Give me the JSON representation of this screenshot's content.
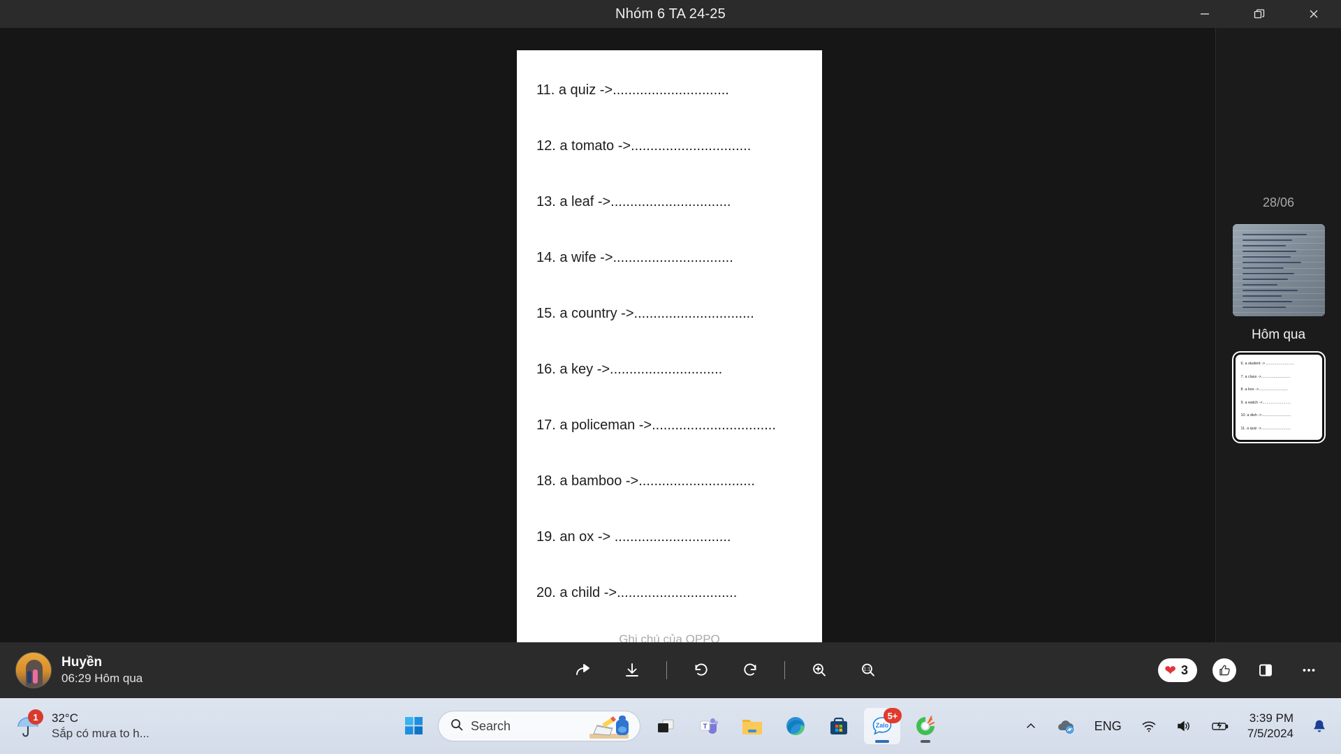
{
  "window": {
    "title": "Nhóm 6 TA 24-25",
    "controls": {
      "minimize": "minimize-button",
      "restore": "restore-button",
      "close": "close-button"
    }
  },
  "document": {
    "lines": [
      "11. a quiz ->..............................",
      "12. a tomato ->...............................",
      "13. a leaf ->...............................",
      "14. a wife ->...............................",
      "15. a country ->...............................",
      "16. a key ->.............................",
      "17. a policeman ->................................",
      "18. a bamboo ->..............................",
      "19. an ox -> ..............................",
      "20. a child ->..............................."
    ],
    "watermark": "Ghi chú của OPPO"
  },
  "rail": {
    "date_label": "28/06",
    "group_label": "Hôm qua",
    "photo_thumb_name": "handwritten-notebook-photo",
    "doc_thumb_lines": [
      "6. a student -> ...........................",
      "7. a class ->............................",
      "8. a box ->............................",
      "9. a watch ->...........................",
      "10. a dish ->............................",
      "11. a quiz ->............................"
    ]
  },
  "actionbar": {
    "author_name": "Huyền",
    "author_time": "06:29 Hôm qua",
    "tools": [
      {
        "name": "share-forward-icon",
        "label": "Chuyển tiếp"
      },
      {
        "name": "download-icon",
        "label": "Tải xuống"
      },
      {
        "name": "rotate-left-icon",
        "label": "Xoay trái"
      },
      {
        "name": "rotate-right-icon",
        "label": "Xoay phải"
      },
      {
        "name": "zoom-in-icon",
        "label": "Phóng to"
      },
      {
        "name": "zoom-actual-size-icon",
        "label": "1:1"
      }
    ],
    "reaction_emoji": "❤",
    "reaction_count": "3",
    "like_icon": "thumbs-up-icon",
    "panel_icon": "side-panel-icon",
    "more_icon": "more-options-icon"
  },
  "taskbar": {
    "weather": {
      "temperature": "32°C",
      "description": "Sắp có mưa to h...",
      "badge": "1",
      "icon": "umbrella-icon"
    },
    "start_icon": "windows-start-icon",
    "search": {
      "icon": "search-icon",
      "placeholder": "Search"
    },
    "apps": [
      {
        "name": "task-view-icon",
        "label": "Task View",
        "badge": "",
        "active": false,
        "running": false
      },
      {
        "name": "microsoft-teams-icon",
        "label": "Microsoft Teams",
        "badge": "",
        "active": false,
        "running": false
      },
      {
        "name": "file-explorer-icon",
        "label": "File Explorer",
        "badge": "",
        "active": false,
        "running": false
      },
      {
        "name": "microsoft-edge-icon",
        "label": "Microsoft Edge",
        "badge": "",
        "active": false,
        "running": false
      },
      {
        "name": "microsoft-store-icon",
        "label": "Microsoft Store",
        "badge": "",
        "active": false,
        "running": false
      },
      {
        "name": "zalo-icon",
        "label": "Zalo",
        "badge": "5+",
        "active": true,
        "running": true
      },
      {
        "name": "green-app-icon",
        "label": "App",
        "badge": "",
        "active": false,
        "running": true
      }
    ],
    "tray": {
      "overflow_icon": "chevron-up-icon",
      "onedrive_icon": "onedrive-sync-icon",
      "language": "ENG",
      "wifi_icon": "wifi-icon",
      "volume_icon": "volume-icon",
      "battery_icon": "battery-charging-icon",
      "time": "3:39 PM",
      "date": "7/5/2024",
      "notification_icon": "notification-bell-icon"
    }
  }
}
